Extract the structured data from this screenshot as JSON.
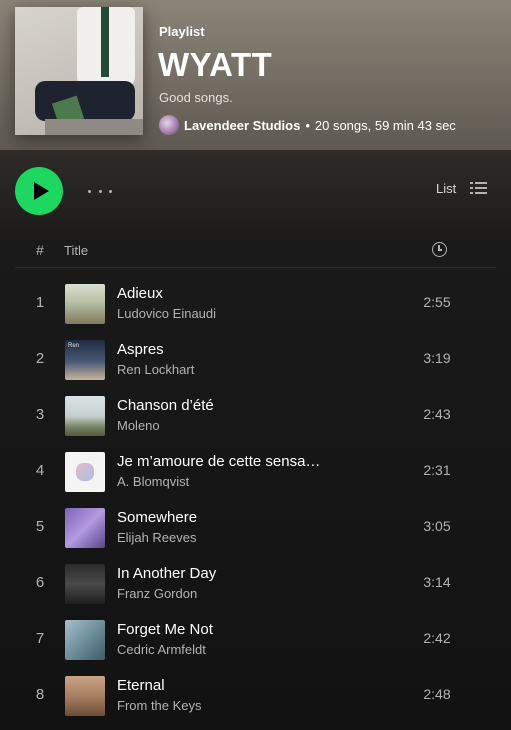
{
  "playlist": {
    "type_label": "Playlist",
    "title": "WYATT",
    "description": "Good songs.",
    "owner": "Lavendeer Studios",
    "separator": "•",
    "stats": "20 songs, 59 min 43 sec"
  },
  "controls": {
    "view_label": "List"
  },
  "columns": {
    "number": "#",
    "title": "Title",
    "duration_icon": "clock-icon"
  },
  "tracks": [
    {
      "number": "1",
      "title": "Adieux",
      "artist": "Ludovico Einaudi",
      "duration": "2:55"
    },
    {
      "number": "2",
      "title": "Aspres",
      "artist": "Ren Lockhart",
      "duration": "3:19",
      "art_text": "Ren"
    },
    {
      "number": "3",
      "title": "Chanson d’été",
      "artist": "Moleno",
      "duration": "2:43"
    },
    {
      "number": "4",
      "title": "Je m’amoure de cette sensa…",
      "artist": "A. Blomqvist",
      "duration": "2:31"
    },
    {
      "number": "5",
      "title": "Somewhere",
      "artist": "Elijah Reeves",
      "duration": "3:05"
    },
    {
      "number": "6",
      "title": "In Another Day",
      "artist": "Franz Gordon",
      "duration": "3:14"
    },
    {
      "number": "7",
      "title": "Forget Me Not",
      "artist": "Cedric Armfeldt",
      "duration": "2:42"
    },
    {
      "number": "8",
      "title": "Eternal",
      "artist": "From the Keys",
      "duration": "2:48"
    }
  ],
  "colors": {
    "accent": "#1ed760",
    "background": "#121212",
    "header": "#7a746a"
  }
}
